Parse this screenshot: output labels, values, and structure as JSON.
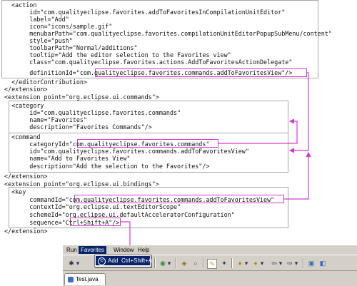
{
  "xml": {
    "lines": [
      "  <action",
      "       id=\"com.qualityeclipse.favorites.addToFavoritesInCompilationUnitEditor\"",
      "       label=\"Add\"",
      "       icon=\"icons/sample.gif\"",
      "       menubarPath=\"com.qualityeclipse.favorites.compilationUnitEditorPopupSubMenu/content\"",
      "       style=\"push\"",
      "       toolbarPath=\"Normal/additions\"",
      "       tooltip=\"Add the editor selection to the Favorites view\"",
      "       class=\"com.qualityeclipse.favorites.actions.AddToFavoritesActionDelegate\"",
      "       definitionId=\"com.qualityeclipse.favorites.commands.addToFavoritesView\"/>",
      "  </editorContribution>",
      "</extension>",
      "<extension point=\"org.eclipse.ui.commands\">",
      "  <category",
      "       id=\"com.qualityeclipse.favorites.commands\"",
      "       name=\"Favorites\"",
      "       description=\"Favorites Commands\"/>",
      "  <command",
      "       categoryId=\"com.qualityeclipse.favorites.commands\"",
      "       id=\"com.qualityeclipse.favorites.commands.addToFavoritesView\"",
      "       name=\"Add to Favorites View\"",
      "       description=\"Add the selection to the Favorites\"/>",
      "</extension>",
      "<extension point=\"org.eclipse.ui.bindings\">",
      "  <key",
      "       commandId=\"com.qualityeclipse.favorites.commands.addToFavoritesView\"",
      "       contextId=\"org.eclipse.ui.textEditorScope\"",
      "       schemeId=\"org.eclipse.ui.defaultAcceleratorConfiguration\"",
      "       sequence=\"Ctrl+Shift+A\"/>",
      "</extension>"
    ]
  },
  "eclipse": {
    "menus": [
      "Run",
      "Favorites",
      "Window",
      "Help"
    ],
    "dropdown_item": {
      "label": "Add",
      "shortcut": "Ctrl+Shift+A"
    },
    "editor_tab": "Test.java",
    "colors": {
      "highlight": "#d63ad6",
      "menu_selected": "#0a246a",
      "chrome": "#d4d0c8"
    }
  }
}
